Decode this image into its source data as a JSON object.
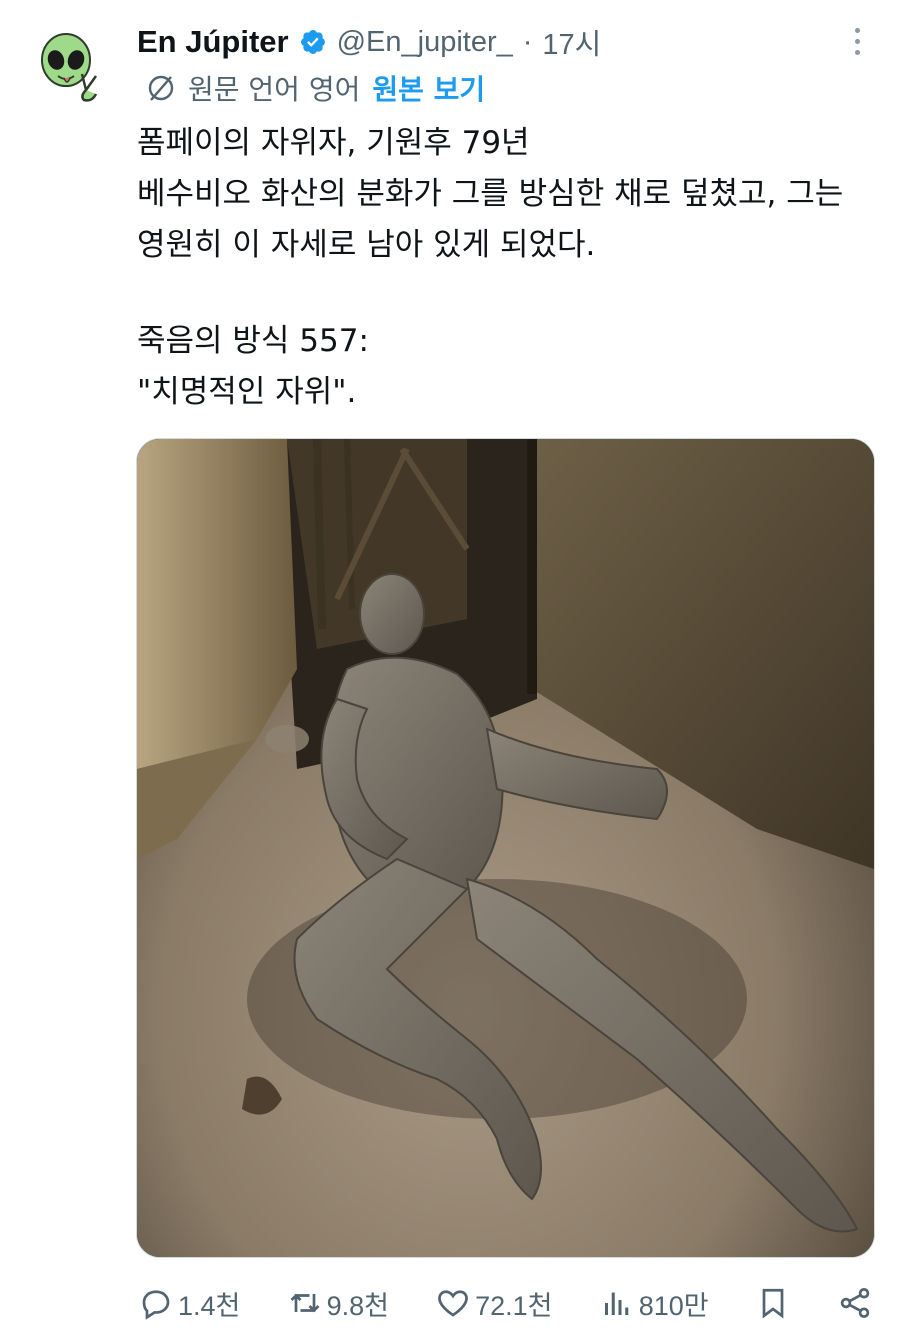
{
  "tweet": {
    "display_name": "En Júpiter",
    "handle": "@En_jupiter_",
    "separator": "·",
    "time": "17시",
    "translate": {
      "label": "원문 언어 영어",
      "link": "원본 보기"
    },
    "text_lines": [
      "폼페이의 자위자, 기원후 79년",
      "베수비오 화산의 분화가 그를 방심한 채로 덮쳤고, 그는",
      "영원히 이 자세로 남아 있게 되었다."
    ],
    "text_lines_2": [
      "죽음의 방식 557:",
      "\"치명적인 자위\"."
    ]
  },
  "actions": {
    "reply_count": "1.4천",
    "retweet_count": "9.8천",
    "like_count": "72.1천",
    "view_count": "810만"
  },
  "icons": {
    "verified": "verified-badge-icon",
    "more": "more-options-icon",
    "translate": "translate-icon",
    "reply": "reply-icon",
    "retweet": "retweet-icon",
    "like": "heart-icon",
    "views": "views-chart-icon",
    "bookmark": "bookmark-icon",
    "share": "share-icon"
  },
  "colors": {
    "accent": "#1d9bf0",
    "muted": "#536471",
    "text": "#0f1419"
  }
}
